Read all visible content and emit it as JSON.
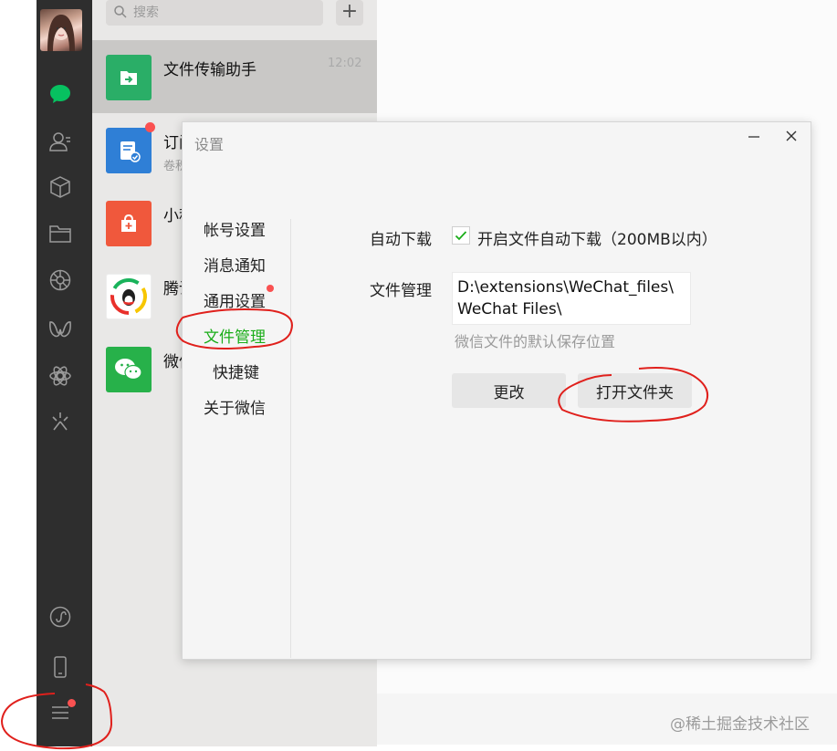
{
  "search": {
    "placeholder": "搜索",
    "add_label": "+"
  },
  "chat_list": [
    {
      "name": "文件传输助手",
      "time": "12:02",
      "subtitle": "",
      "avatar_color": "#2aae67",
      "icon": "file-transfer-icon"
    },
    {
      "name": "订阅号",
      "time": "",
      "subtitle": "卷积",
      "avatar_color": "#2f7fd6",
      "icon": "subscription-icon"
    },
    {
      "name": "小程序",
      "time": "",
      "subtitle": "",
      "avatar_color": "#f0583c",
      "icon": "mini-program-icon"
    },
    {
      "name": "腾讯",
      "time": "",
      "subtitle": "",
      "avatar_color": "#ffffff",
      "icon": "tencent-qq-icon"
    },
    {
      "name": "微信",
      "time": "",
      "subtitle": "",
      "avatar_color": "#27b14a",
      "icon": "wechat-icon"
    }
  ],
  "dialog": {
    "title": "设置",
    "nav": {
      "account": "帐号设置",
      "notify": "消息通知",
      "general": "通用设置",
      "files": "文件管理",
      "shortcuts": "快捷键",
      "about": "关于微信"
    },
    "auto_download_label": "自动下载",
    "auto_download_option": "开启文件自动下载（200MB以内）",
    "auto_download_checked": true,
    "file_manage_label": "文件管理",
    "path_line1": "D:\\extensions\\WeChat_files\\",
    "path_line2": "WeChat Files\\",
    "path_hint": "微信文件的默认保存位置",
    "change_button": "更改",
    "open_folder_button": "打开文件夹"
  },
  "watermark": "@稀土掘金技术社区",
  "colors": {
    "sidebar_bg": "#2e2e2e",
    "accent_green": "#1aad19",
    "chat_icon_green": "#07c160",
    "badge_red": "#fa5151",
    "annotation_red": "#e0201c"
  }
}
